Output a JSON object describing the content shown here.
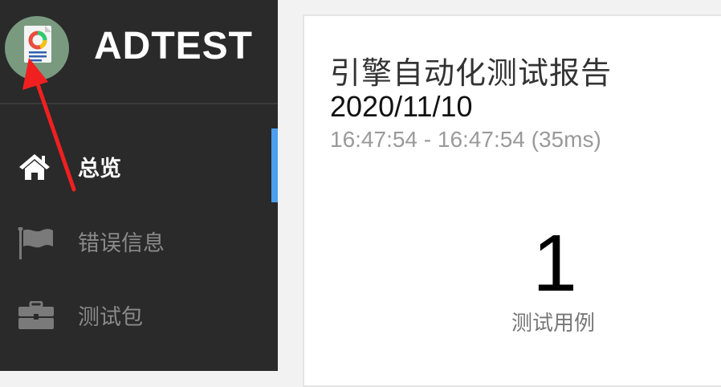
{
  "brand": {
    "name": "ADTEST",
    "logo_icon": "report-chart-icon"
  },
  "sidebar": {
    "items": [
      {
        "label": "总览",
        "icon": "home-icon",
        "active": true
      },
      {
        "label": "错误信息",
        "icon": "flag-icon",
        "active": false
      },
      {
        "label": "测试包",
        "icon": "briefcase-icon",
        "active": false
      }
    ]
  },
  "report": {
    "title": "引擎自动化测试报告",
    "date": "2020/11/10",
    "time_range": "16:47:54 - 16:47:54 (35ms)",
    "stat": {
      "value": "1",
      "label": "测试用例"
    }
  },
  "colors": {
    "sidebar_bg": "#2a2a2a",
    "accent": "#4a9ff0",
    "arrow": "#f02020"
  }
}
